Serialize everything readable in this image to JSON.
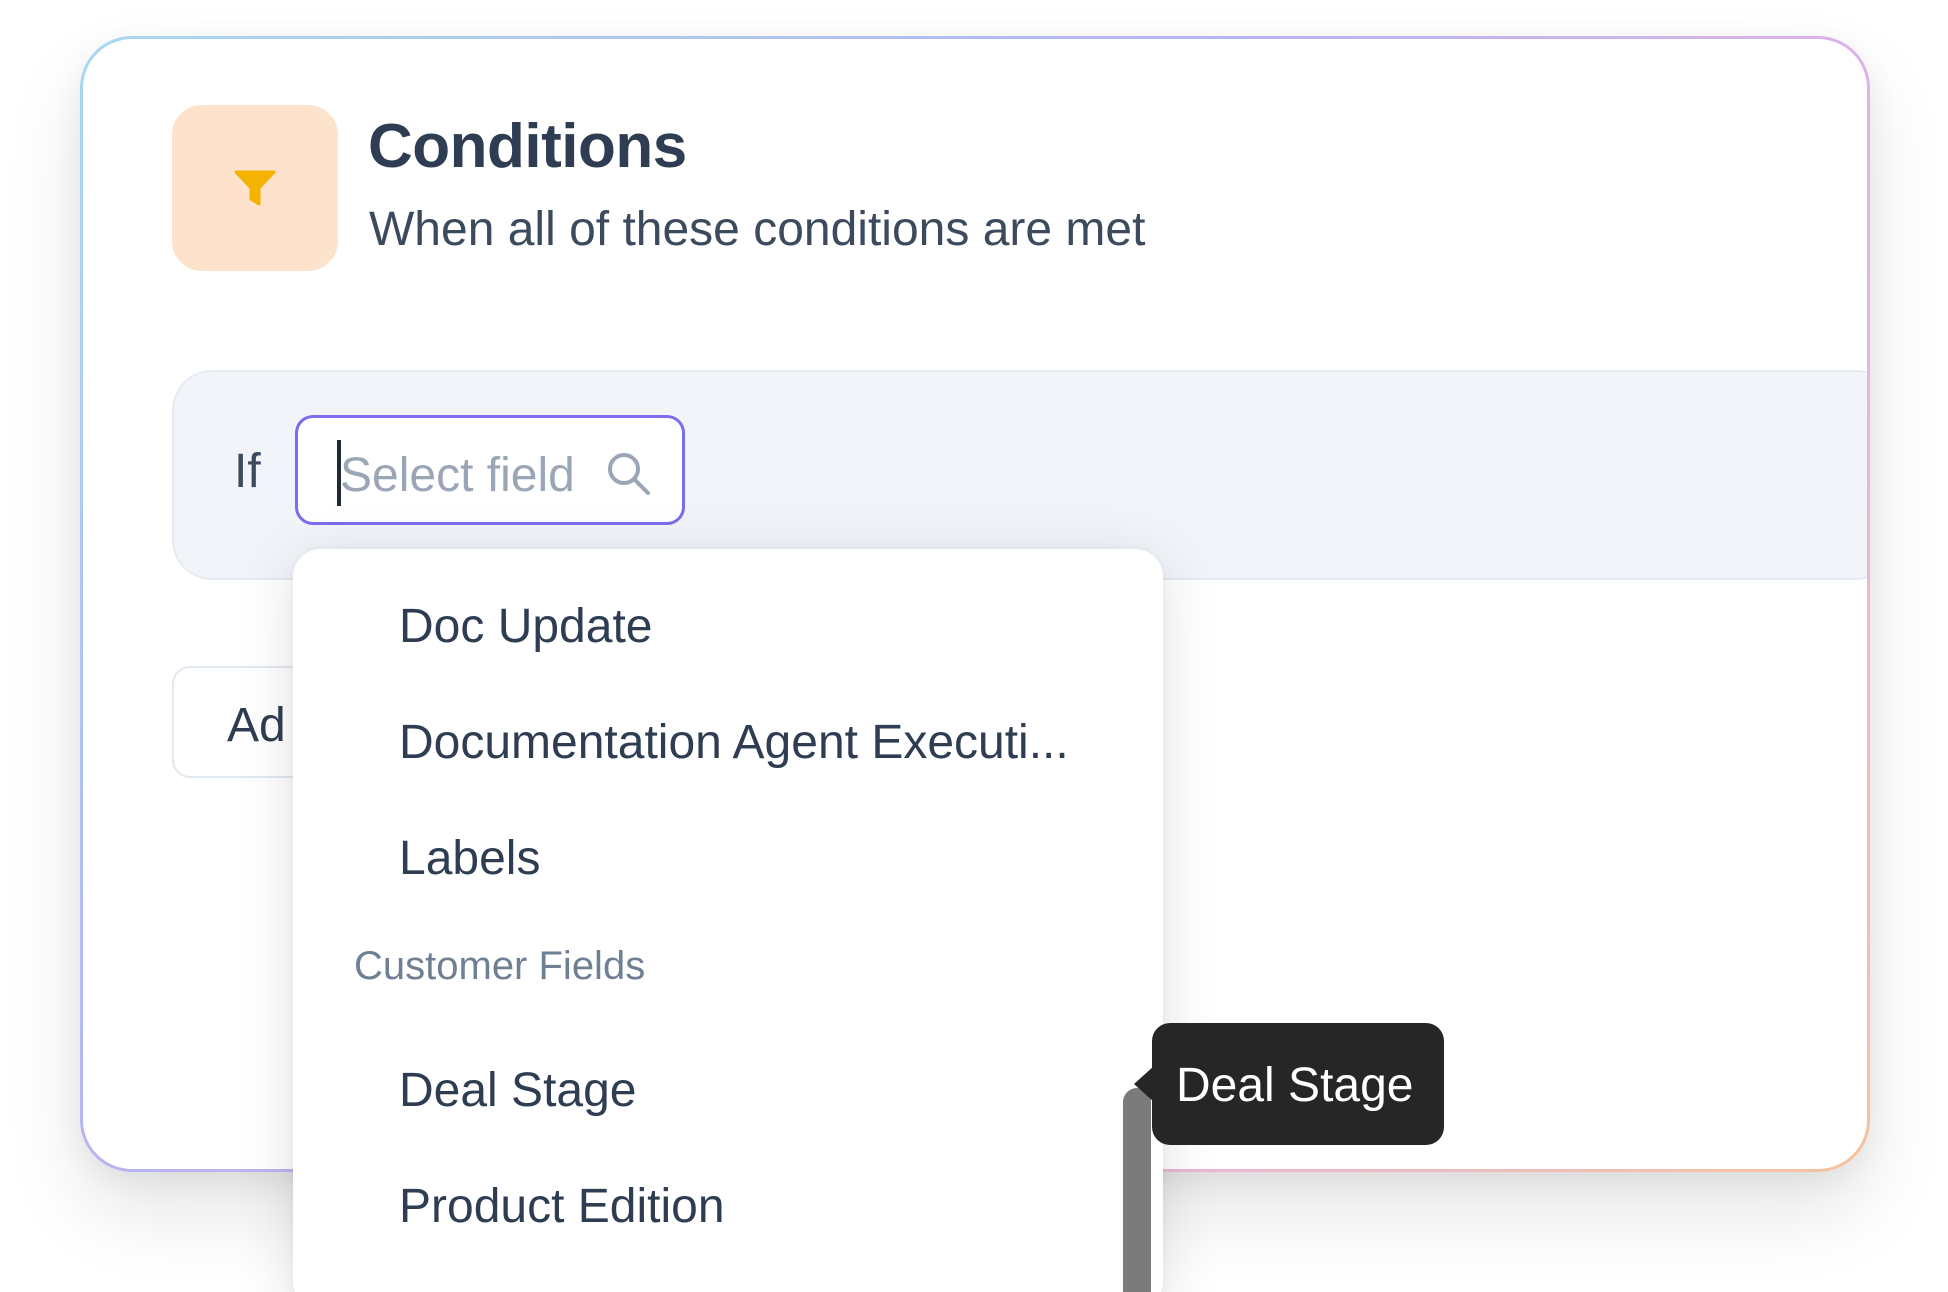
{
  "header": {
    "title": "Conditions",
    "subtitle": "When all of these conditions are met",
    "icon": "filter-icon",
    "icon_color": "#f5b301",
    "icon_bg": "#fde2cc"
  },
  "condition": {
    "if_label": "If",
    "select_placeholder": "Select field",
    "search_icon": "search-icon"
  },
  "add_button": {
    "label": "Ad"
  },
  "dropdown": {
    "items_top": [
      "Doc Update",
      "Documentation Agent Executi...",
      "Labels"
    ],
    "group_label": "Customer Fields",
    "items_group": [
      "Deal Stage",
      "Product Edition"
    ]
  },
  "tooltip": {
    "text": "Deal Stage"
  },
  "colors": {
    "accent": "#7c6cf0",
    "title": "#2e3d52",
    "tooltip_bg": "#262626"
  }
}
